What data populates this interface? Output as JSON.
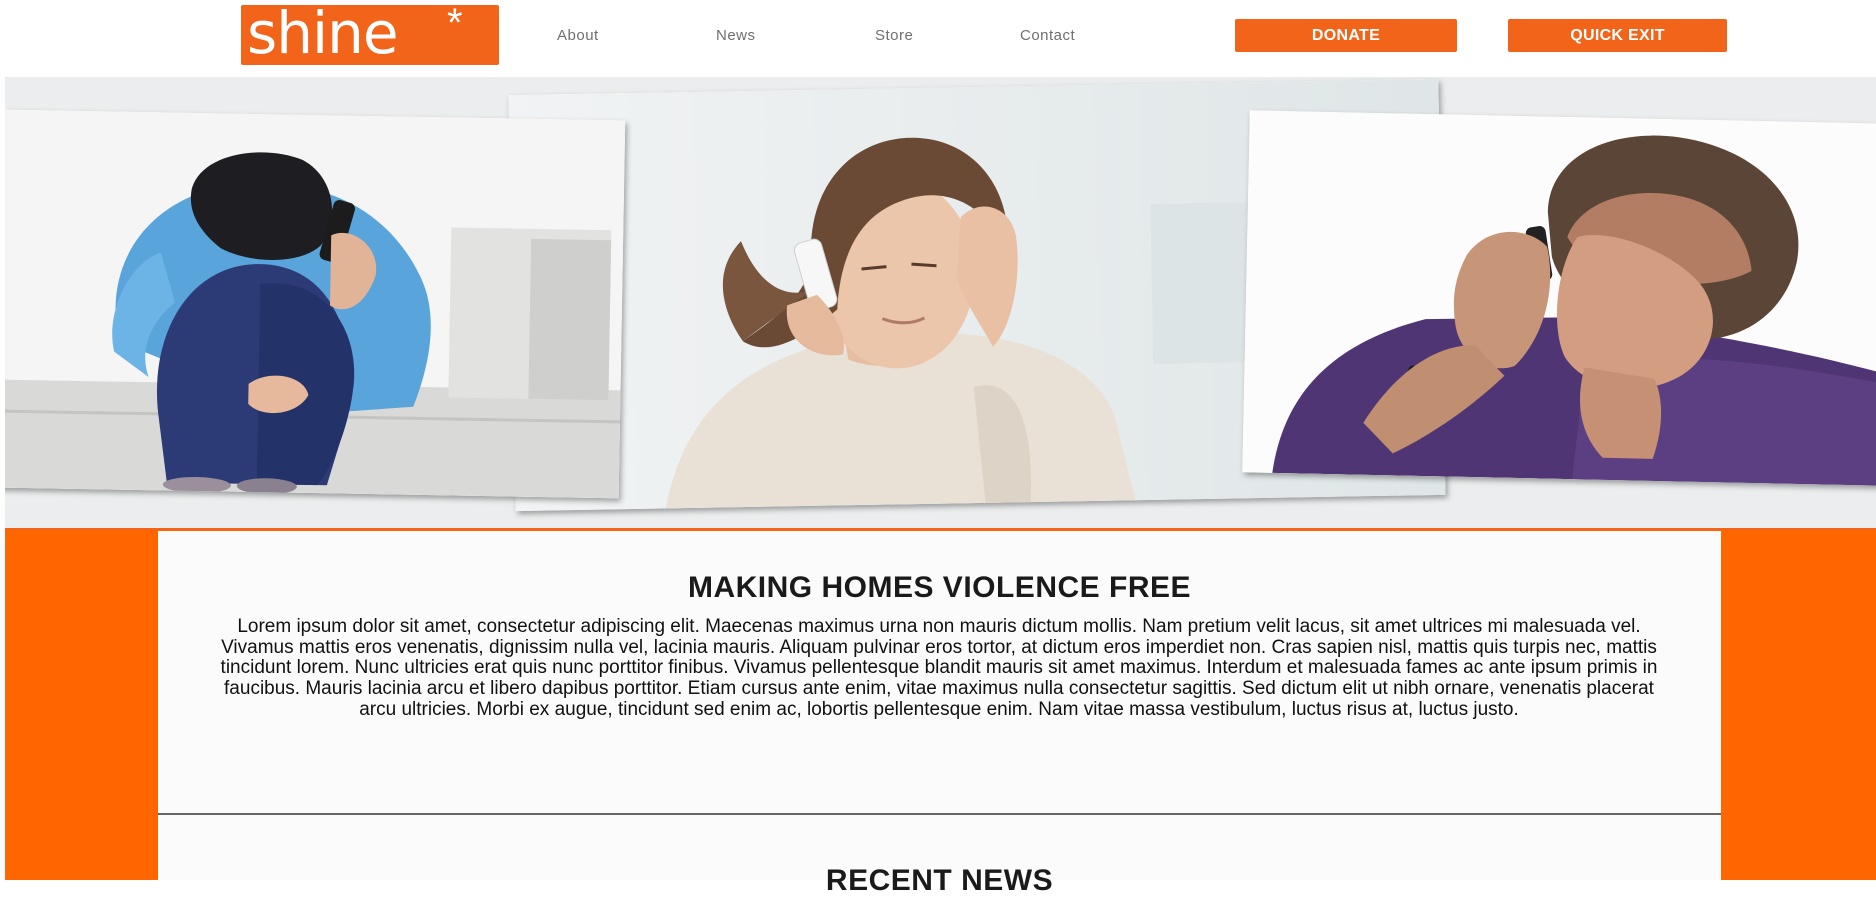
{
  "header": {
    "logo_text": "shine",
    "logo_star": "*",
    "nav": [
      {
        "label": "About"
      },
      {
        "label": "News"
      },
      {
        "label": "Store"
      },
      {
        "label": "Contact"
      }
    ],
    "donate_label": "DONATE",
    "quick_exit_label": "QUICK EXIT"
  },
  "hero": {
    "photos": [
      {
        "subject": "woman-crouching-on-phone"
      },
      {
        "subject": "woman-distressed-on-phone"
      },
      {
        "subject": "man-covering-face-on-phone"
      }
    ]
  },
  "intro": {
    "heading": "MAKING HOMES VIOLENCE FREE",
    "body": "Lorem ipsum dolor sit amet, consectetur adipiscing elit. Maecenas maximus urna non mauris dictum mollis. Nam pretium velit lacus, sit amet ultrices mi malesuada vel. Vivamus mattis eros venenatis, dignissim nulla vel, lacinia mauris. Aliquam pulvinar eros tortor, at dictum eros imperdiet non. Cras sapien nisl, mattis quis turpis nec, mattis tincidunt lorem. Nunc ultricies erat quis nunc porttitor finibus. Vivamus pellentesque blandit mauris sit amet maximus. Interdum et malesuada fames ac ante ipsum primis in faucibus. Mauris lacinia arcu et libero dapibus porttitor. Etiam cursus ante enim, vitae maximus nulla consectetur sagittis. Sed dictum elit ut nibh ornare, venenatis placerat arcu ultricies. Morbi ex augue, tincidunt sed enim ac, lobortis pellentesque enim. Nam vitae massa vestibulum, luctus risus at, luctus justo."
  },
  "recent_news": {
    "heading": "RECENT NEWS"
  },
  "colors": {
    "brand_orange": "#f26419",
    "band_orange": "#ff6600",
    "hero_background": "#ebedee",
    "panel_background": "#fbfbfb",
    "nav_text": "#707070"
  }
}
